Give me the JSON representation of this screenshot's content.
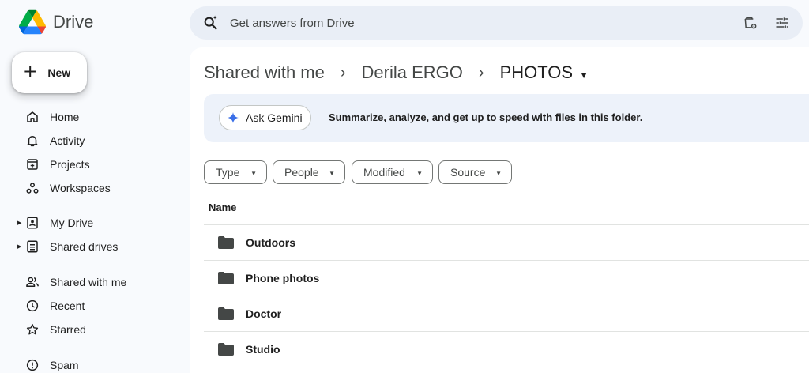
{
  "app": {
    "name": "Drive"
  },
  "sidebar": {
    "new_label": "New",
    "items": [
      {
        "label": "Home",
        "icon": "home-icon"
      },
      {
        "label": "Activity",
        "icon": "bell-icon"
      },
      {
        "label": "Projects",
        "icon": "projects-icon"
      },
      {
        "label": "Workspaces",
        "icon": "workspaces-icon"
      },
      {
        "label": "My Drive",
        "icon": "my-drive-icon"
      },
      {
        "label": "Shared drives",
        "icon": "shared-drives-icon"
      },
      {
        "label": "Shared with me",
        "icon": "people-icon"
      },
      {
        "label": "Recent",
        "icon": "clock-icon"
      },
      {
        "label": "Starred",
        "icon": "star-icon"
      },
      {
        "label": "Spam",
        "icon": "spam-icon"
      }
    ]
  },
  "search": {
    "placeholder": "Get answers from Drive"
  },
  "breadcrumb": {
    "items": [
      "Shared with me",
      "Derila ERGO"
    ],
    "current": "PHOTOS"
  },
  "gemini": {
    "button_label": "Ask Gemini",
    "description": "Summarize, analyze, and get up to speed with files in this folder."
  },
  "filters": [
    "Type",
    "People",
    "Modified",
    "Source"
  ],
  "list": {
    "column_name": "Name",
    "rows": [
      "Outdoors",
      "Phone photos",
      "Doctor",
      "Studio"
    ]
  },
  "colors": {
    "accent_blue": "#0b57d0",
    "background": "#f8fafd",
    "search_bg": "#e9eef6",
    "gemini_bar_bg": "#edf2fa",
    "folder": "#444746"
  }
}
